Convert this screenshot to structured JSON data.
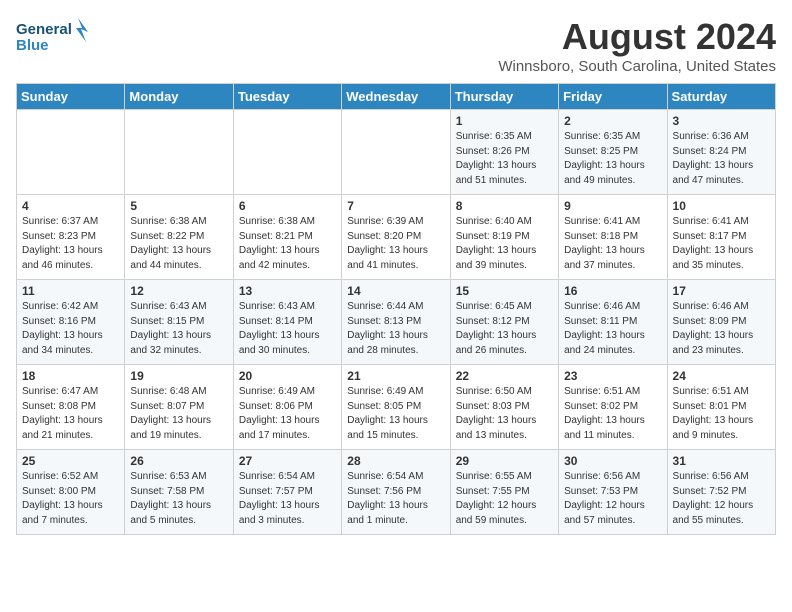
{
  "logo": {
    "line1": "General",
    "line2": "Blue"
  },
  "title": "August 2024",
  "subtitle": "Winnsboro, South Carolina, United States",
  "weekdays": [
    "Sunday",
    "Monday",
    "Tuesday",
    "Wednesday",
    "Thursday",
    "Friday",
    "Saturday"
  ],
  "weeks": [
    [
      {
        "day": "",
        "sunrise": "",
        "sunset": "",
        "daylight": ""
      },
      {
        "day": "",
        "sunrise": "",
        "sunset": "",
        "daylight": ""
      },
      {
        "day": "",
        "sunrise": "",
        "sunset": "",
        "daylight": ""
      },
      {
        "day": "",
        "sunrise": "",
        "sunset": "",
        "daylight": ""
      },
      {
        "day": "1",
        "sunrise": "Sunrise: 6:35 AM",
        "sunset": "Sunset: 8:26 PM",
        "daylight": "Daylight: 13 hours and 51 minutes."
      },
      {
        "day": "2",
        "sunrise": "Sunrise: 6:35 AM",
        "sunset": "Sunset: 8:25 PM",
        "daylight": "Daylight: 13 hours and 49 minutes."
      },
      {
        "day": "3",
        "sunrise": "Sunrise: 6:36 AM",
        "sunset": "Sunset: 8:24 PM",
        "daylight": "Daylight: 13 hours and 47 minutes."
      }
    ],
    [
      {
        "day": "4",
        "sunrise": "Sunrise: 6:37 AM",
        "sunset": "Sunset: 8:23 PM",
        "daylight": "Daylight: 13 hours and 46 minutes."
      },
      {
        "day": "5",
        "sunrise": "Sunrise: 6:38 AM",
        "sunset": "Sunset: 8:22 PM",
        "daylight": "Daylight: 13 hours and 44 minutes."
      },
      {
        "day": "6",
        "sunrise": "Sunrise: 6:38 AM",
        "sunset": "Sunset: 8:21 PM",
        "daylight": "Daylight: 13 hours and 42 minutes."
      },
      {
        "day": "7",
        "sunrise": "Sunrise: 6:39 AM",
        "sunset": "Sunset: 8:20 PM",
        "daylight": "Daylight: 13 hours and 41 minutes."
      },
      {
        "day": "8",
        "sunrise": "Sunrise: 6:40 AM",
        "sunset": "Sunset: 8:19 PM",
        "daylight": "Daylight: 13 hours and 39 minutes."
      },
      {
        "day": "9",
        "sunrise": "Sunrise: 6:41 AM",
        "sunset": "Sunset: 8:18 PM",
        "daylight": "Daylight: 13 hours and 37 minutes."
      },
      {
        "day": "10",
        "sunrise": "Sunrise: 6:41 AM",
        "sunset": "Sunset: 8:17 PM",
        "daylight": "Daylight: 13 hours and 35 minutes."
      }
    ],
    [
      {
        "day": "11",
        "sunrise": "Sunrise: 6:42 AM",
        "sunset": "Sunset: 8:16 PM",
        "daylight": "Daylight: 13 hours and 34 minutes."
      },
      {
        "day": "12",
        "sunrise": "Sunrise: 6:43 AM",
        "sunset": "Sunset: 8:15 PM",
        "daylight": "Daylight: 13 hours and 32 minutes."
      },
      {
        "day": "13",
        "sunrise": "Sunrise: 6:43 AM",
        "sunset": "Sunset: 8:14 PM",
        "daylight": "Daylight: 13 hours and 30 minutes."
      },
      {
        "day": "14",
        "sunrise": "Sunrise: 6:44 AM",
        "sunset": "Sunset: 8:13 PM",
        "daylight": "Daylight: 13 hours and 28 minutes."
      },
      {
        "day": "15",
        "sunrise": "Sunrise: 6:45 AM",
        "sunset": "Sunset: 8:12 PM",
        "daylight": "Daylight: 13 hours and 26 minutes."
      },
      {
        "day": "16",
        "sunrise": "Sunrise: 6:46 AM",
        "sunset": "Sunset: 8:11 PM",
        "daylight": "Daylight: 13 hours and 24 minutes."
      },
      {
        "day": "17",
        "sunrise": "Sunrise: 6:46 AM",
        "sunset": "Sunset: 8:09 PM",
        "daylight": "Daylight: 13 hours and 23 minutes."
      }
    ],
    [
      {
        "day": "18",
        "sunrise": "Sunrise: 6:47 AM",
        "sunset": "Sunset: 8:08 PM",
        "daylight": "Daylight: 13 hours and 21 minutes."
      },
      {
        "day": "19",
        "sunrise": "Sunrise: 6:48 AM",
        "sunset": "Sunset: 8:07 PM",
        "daylight": "Daylight: 13 hours and 19 minutes."
      },
      {
        "day": "20",
        "sunrise": "Sunrise: 6:49 AM",
        "sunset": "Sunset: 8:06 PM",
        "daylight": "Daylight: 13 hours and 17 minutes."
      },
      {
        "day": "21",
        "sunrise": "Sunrise: 6:49 AM",
        "sunset": "Sunset: 8:05 PM",
        "daylight": "Daylight: 13 hours and 15 minutes."
      },
      {
        "day": "22",
        "sunrise": "Sunrise: 6:50 AM",
        "sunset": "Sunset: 8:03 PM",
        "daylight": "Daylight: 13 hours and 13 minutes."
      },
      {
        "day": "23",
        "sunrise": "Sunrise: 6:51 AM",
        "sunset": "Sunset: 8:02 PM",
        "daylight": "Daylight: 13 hours and 11 minutes."
      },
      {
        "day": "24",
        "sunrise": "Sunrise: 6:51 AM",
        "sunset": "Sunset: 8:01 PM",
        "daylight": "Daylight: 13 hours and 9 minutes."
      }
    ],
    [
      {
        "day": "25",
        "sunrise": "Sunrise: 6:52 AM",
        "sunset": "Sunset: 8:00 PM",
        "daylight": "Daylight: 13 hours and 7 minutes."
      },
      {
        "day": "26",
        "sunrise": "Sunrise: 6:53 AM",
        "sunset": "Sunset: 7:58 PM",
        "daylight": "Daylight: 13 hours and 5 minutes."
      },
      {
        "day": "27",
        "sunrise": "Sunrise: 6:54 AM",
        "sunset": "Sunset: 7:57 PM",
        "daylight": "Daylight: 13 hours and 3 minutes."
      },
      {
        "day": "28",
        "sunrise": "Sunrise: 6:54 AM",
        "sunset": "Sunset: 7:56 PM",
        "daylight": "Daylight: 13 hours and 1 minute."
      },
      {
        "day": "29",
        "sunrise": "Sunrise: 6:55 AM",
        "sunset": "Sunset: 7:55 PM",
        "daylight": "Daylight: 12 hours and 59 minutes."
      },
      {
        "day": "30",
        "sunrise": "Sunrise: 6:56 AM",
        "sunset": "Sunset: 7:53 PM",
        "daylight": "Daylight: 12 hours and 57 minutes."
      },
      {
        "day": "31",
        "sunrise": "Sunrise: 6:56 AM",
        "sunset": "Sunset: 7:52 PM",
        "daylight": "Daylight: 12 hours and 55 minutes."
      }
    ]
  ]
}
